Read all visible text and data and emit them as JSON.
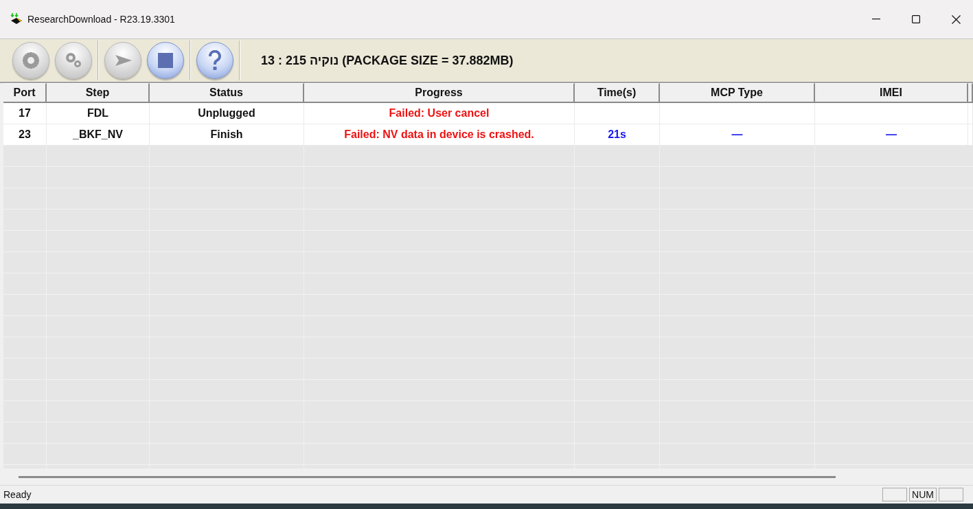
{
  "window": {
    "title": "ResearchDownload - R23.19.3301"
  },
  "toolbar": {
    "buttons": [
      {
        "kind": "gear",
        "disabled": true
      },
      {
        "kind": "gears",
        "disabled": true
      },
      {
        "kind": "start",
        "disabled": true
      },
      {
        "kind": "stop",
        "disabled": false
      },
      {
        "kind": "help",
        "disabled": false
      }
    ],
    "package_info": "13 : 215 נוקיה (PACKAGE SIZE = 37.882MB)"
  },
  "table": {
    "columns": [
      "Port",
      "Step",
      "Status",
      "Progress",
      "Time(s)",
      "MCP Type",
      "IMEI"
    ],
    "rows": [
      {
        "port": "17",
        "step": "FDL",
        "status": "Unplugged",
        "progress": "Failed: User cancel",
        "time": "",
        "mcp_type": "",
        "imei": ""
      },
      {
        "port": "23",
        "step": "_BKF_NV",
        "status": "Finish",
        "progress": "Failed: NV data in device is crashed.",
        "time": "21s",
        "mcp_type": "—",
        "imei": "—"
      }
    ]
  },
  "status_bar": {
    "text": "Ready",
    "indicator": "NUM"
  }
}
